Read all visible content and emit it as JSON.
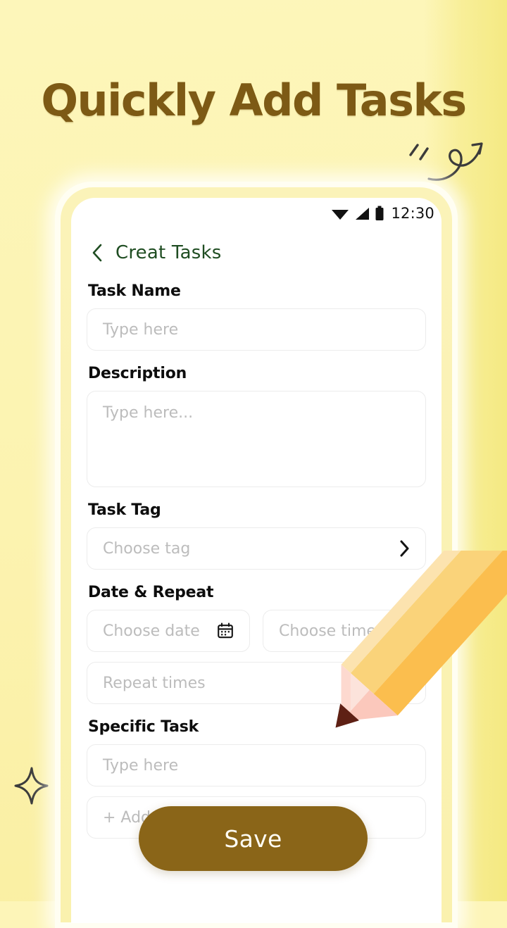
{
  "hero": {
    "title": "Quickly Add Tasks",
    "title_color": "#7d5a15"
  },
  "background": {
    "color": "#FDF5B8"
  },
  "decorations": {
    "arrow_doodle": "curly-arrow-doodle",
    "sparkle_doodle": "four-point-sparkle-doodle",
    "pencil": "pencil-illustration"
  },
  "phone": {
    "statusbar": {
      "wifi_icon": "wifi-icon",
      "signal_icon": "signal-icon",
      "battery_icon": "battery-icon",
      "clock": "12:30"
    },
    "header": {
      "back_icon": "chevron-left-icon",
      "title": "Creat Tasks",
      "title_color": "#1f4d22"
    },
    "form": {
      "task_name": {
        "label": "Task Name",
        "placeholder": "Type here",
        "value": ""
      },
      "description": {
        "label": "Description",
        "placeholder": "Type here...",
        "value": ""
      },
      "task_tag": {
        "label": "Task Tag",
        "placeholder": "Choose tag",
        "value": "",
        "chevron_icon": "chevron-right-icon"
      },
      "date_repeat": {
        "label": "Date & Repeat",
        "date_placeholder": "Choose date",
        "date_icon": "calendar-icon",
        "time_placeholder": "Choose time",
        "repeat_placeholder": "Repeat times"
      },
      "specific_task": {
        "label": "Specific Task",
        "placeholder": "Type here",
        "add_task_label": "+ Add Task"
      }
    },
    "save_button": {
      "label": "Save",
      "color": "#8A6518",
      "text_color": "#FFFDF4"
    }
  }
}
